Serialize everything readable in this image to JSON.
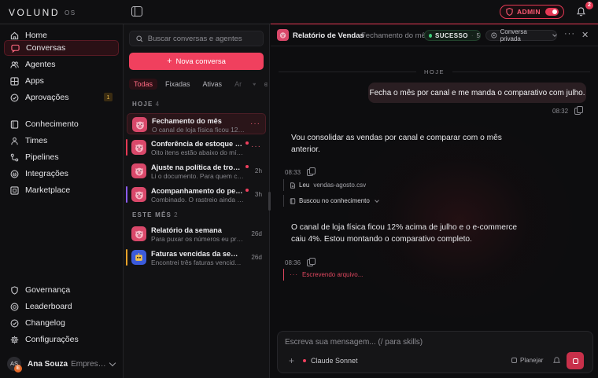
{
  "app": {
    "logo": "VOLUND",
    "logo_suffix": "OS"
  },
  "topbar": {
    "admin_label": "ADMIN",
    "admin_mode_on": true,
    "notification_count": "2"
  },
  "colors": {
    "accent": "#f0405e",
    "success": "#3fd07a",
    "warning": "#e7b64a"
  },
  "sidebar": {
    "primary": [
      {
        "label": "Home",
        "icon": "home-icon"
      },
      {
        "label": "Conversas",
        "icon": "chat-icon",
        "active": true
      },
      {
        "label": "Agentes",
        "icon": "users-icon"
      },
      {
        "label": "Apps",
        "icon": "grid-icon"
      },
      {
        "label": "Aprovações",
        "icon": "check-circle-icon",
        "count": "1"
      }
    ],
    "secondary": [
      {
        "label": "Conhecimento",
        "icon": "book-icon"
      },
      {
        "label": "Times",
        "icon": "team-icon"
      },
      {
        "label": "Pipelines",
        "icon": "pipeline-icon"
      },
      {
        "label": "Integrações",
        "icon": "plug-icon"
      },
      {
        "label": "Marketplace",
        "icon": "store-icon"
      }
    ],
    "bottom": [
      {
        "label": "Governança",
        "icon": "shield-icon"
      },
      {
        "label": "Leaderboard",
        "icon": "trophy-icon"
      },
      {
        "label": "Changelog",
        "icon": "check-badge-icon"
      },
      {
        "label": "Configurações",
        "icon": "gear-icon"
      }
    ],
    "user": {
      "initials": "AS",
      "badge": "E",
      "name": "Ana Souza",
      "org": "Empresa ..."
    }
  },
  "convlist": {
    "search_placeholder": "Buscar conversas e agentes",
    "new_button": "Nova conversa",
    "filters": [
      "Todas",
      "Fixadas",
      "Ativas",
      "Ar"
    ],
    "sections": [
      {
        "label": "HOJE",
        "count": "4"
      },
      {
        "label": "ESTE MÊS",
        "count": "2"
      }
    ],
    "items": [
      {
        "title": "Fechamento do mês",
        "preview": "O canal de loja física ficou 12% ...",
        "time": "",
        "avatar": "pig",
        "av_color": "#d9486a",
        "bar": "",
        "unread": false,
        "active": true,
        "menu": true
      },
      {
        "title": "Conferência de estoque do ...",
        "preview": "Oito itens estão abaixo do mínimo...",
        "time": "",
        "avatar": "pig",
        "av_color": "#d9486a",
        "bar": "#e53955",
        "unread": true,
        "active": false,
        "menu": true
      },
      {
        "title": "Ajuste na política de trocas",
        "preview": "Li o documento. Para quem comp...",
        "time": "2h",
        "avatar": "pig",
        "av_color": "#d9486a",
        "bar": "",
        "unread": true,
        "active": false,
        "menu": false
      },
      {
        "title": "Acompanhamento do pedido...",
        "preview": "Combinado. O rastreio ainda está ...",
        "time": "3h",
        "avatar": "pig",
        "av_color": "#d9486a",
        "bar": "#8b5cf6",
        "unread": true,
        "active": false,
        "menu": false
      },
      {
        "title": "Relatório da semana",
        "preview": "Para puxar os números eu precis...",
        "time": "26d",
        "avatar": "pig",
        "av_color": "#d9486a",
        "bar": "",
        "unread": false,
        "active": false,
        "menu": false
      },
      {
        "title": "Faturas vencidas da semana",
        "preview": "Encontrei três faturas vencidas n...",
        "time": "26d",
        "avatar": "robot",
        "av_color": "#3b5bdb",
        "bar": "#e7a22a",
        "unread": false,
        "active": false,
        "menu": false
      }
    ]
  },
  "chat": {
    "title": "Relatório de Vendas",
    "subtitle": "Fechamento do mês",
    "status": {
      "label": "SUCESSO",
      "count": "5"
    },
    "privacy": "Conversa privada",
    "day_label": "HOJE",
    "user_message": {
      "text": "Fecha o mês por canal e me manda o comparativo com julho.",
      "time": "08:32"
    },
    "bot_message_1": {
      "text": "Vou consolidar as vendas por canal e comparar com o mês anterior.",
      "time": "08:33"
    },
    "tools": [
      {
        "verb": "Leu",
        "arg": "vendas-agosto.csv",
        "icon": "file-icon"
      },
      {
        "verb": "Buscou no conhecimento",
        "arg": "",
        "icon": "book-icon",
        "expandable": true
      }
    ],
    "bot_message_2": {
      "text": "O canal de loja física ficou 12% acima de julho e o e-commerce caiu 4%. Estou montando o comparativo completo.",
      "time": "08:36"
    },
    "typing": "Escrevendo arquivo...",
    "composer": {
      "placeholder": "Escreva sua mensagem... (/ para skills)",
      "model": "Claude Sonnet",
      "plan_label": "Planejar"
    }
  }
}
